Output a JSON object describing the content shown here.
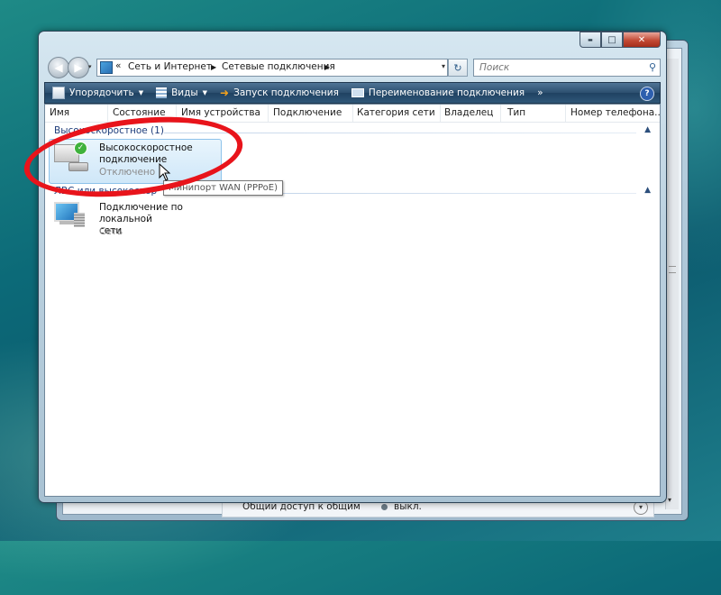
{
  "colors": {
    "accent_red": "#e8141b",
    "toolbar_bg": "#2c4f6f",
    "group_text": "#1e3d7b",
    "selection_bg": "#cfe7f8"
  },
  "window": {
    "caption_buttons": {
      "minimize": "▬",
      "maximize": "□",
      "close": "✕"
    }
  },
  "nav": {
    "back_icon": "back-arrow-icon",
    "forward_icon": "forward-arrow-icon",
    "address": {
      "overflow": "«",
      "crumbs": [
        "Сеть и Интернет",
        "Сетевые подключения"
      ]
    },
    "search": {
      "placeholder": "Поиск",
      "value": ""
    }
  },
  "toolbar": {
    "organize": "Упорядочить",
    "views": "Виды",
    "start_connection": "Запуск подключения",
    "rename_connection": "Переименование подключения",
    "more": "»",
    "help": "?"
  },
  "columns": [
    "Имя",
    "Состояние",
    "Имя устройства",
    "Подключение",
    "Категория сети",
    "Владелец",
    "Тип",
    "Номер телефона..."
  ],
  "groups": [
    {
      "header": "Высокоскоростное (1)",
      "items": [
        {
          "name_line1": "Высокоскоростное",
          "name_line2": "подключение",
          "status": "Отключено"
        }
      ]
    },
    {
      "header": "ЛВС или высокоскор",
      "items": [
        {
          "name_line1": "Подключение по локальной",
          "name_line2": "сети",
          "status": "Сеть"
        }
      ]
    }
  ],
  "tooltip": "Минипорт WAN (PPPoE)",
  "background_window": {
    "row_label": "Общий доступ к общим",
    "row_value": "выкл."
  }
}
